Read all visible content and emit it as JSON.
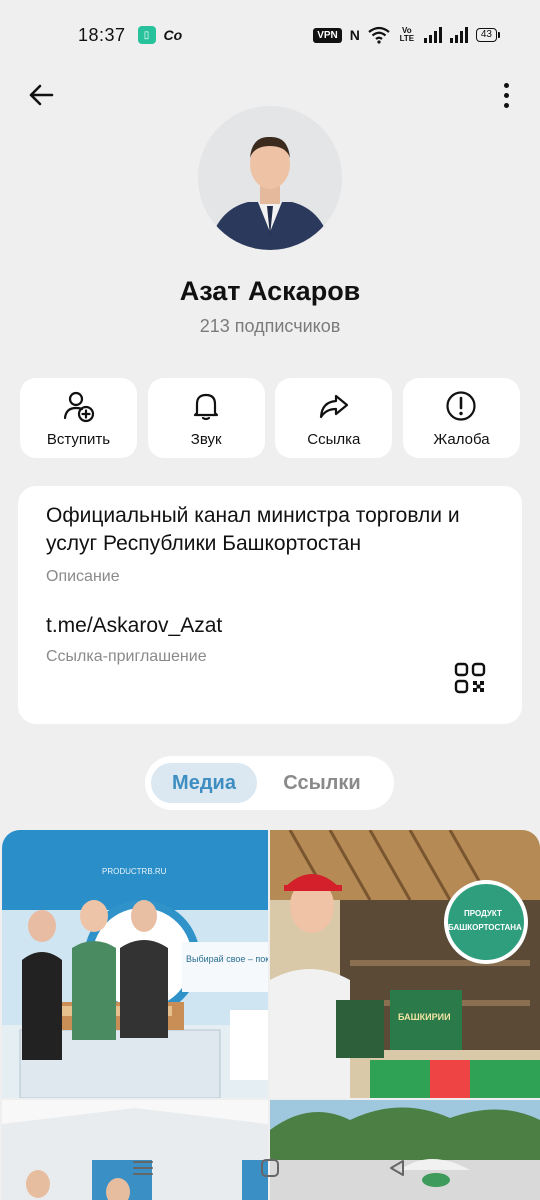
{
  "status_bar": {
    "time": "18:37",
    "app_icon_glyph": "▯",
    "app2_glyph": "Co",
    "vpn": "VPN",
    "nfc": "N",
    "volte": "Vo LTE",
    "battery": "43"
  },
  "profile": {
    "name": "Азат Аскаров",
    "subscribers": "213 подписчиков"
  },
  "actions": [
    {
      "label": "Вступить",
      "icon": "add-user-icon"
    },
    {
      "label": "Звук",
      "icon": "bell-icon"
    },
    {
      "label": "Ссылка",
      "icon": "share-icon"
    },
    {
      "label": "Жалоба",
      "icon": "exclamation-icon"
    }
  ],
  "info": {
    "description": "Официальный канал министра торговли и услуг Республики Башкортостан",
    "description_caption": "Описание",
    "link": "t.me/Askarov_Azat",
    "link_caption": "Ссылка-приглашение"
  },
  "tabs": {
    "media": "Медиа",
    "links": "Ссылки"
  },
  "media_text": {
    "tile1_site": "PRODUCTRB.RU",
    "tile1_slogan": "Выбирай свое – покупай родное!",
    "tile2_badge_line1": "ПРОДУКТ",
    "tile2_badge_line2": "БАШКОРТОСТАНА",
    "tile2_box": "БАШКИРИИ"
  },
  "colors": {
    "accent": "#3f8ec2",
    "background": "#efefef",
    "card": "#ffffff",
    "muted": "#8a8a8a"
  }
}
